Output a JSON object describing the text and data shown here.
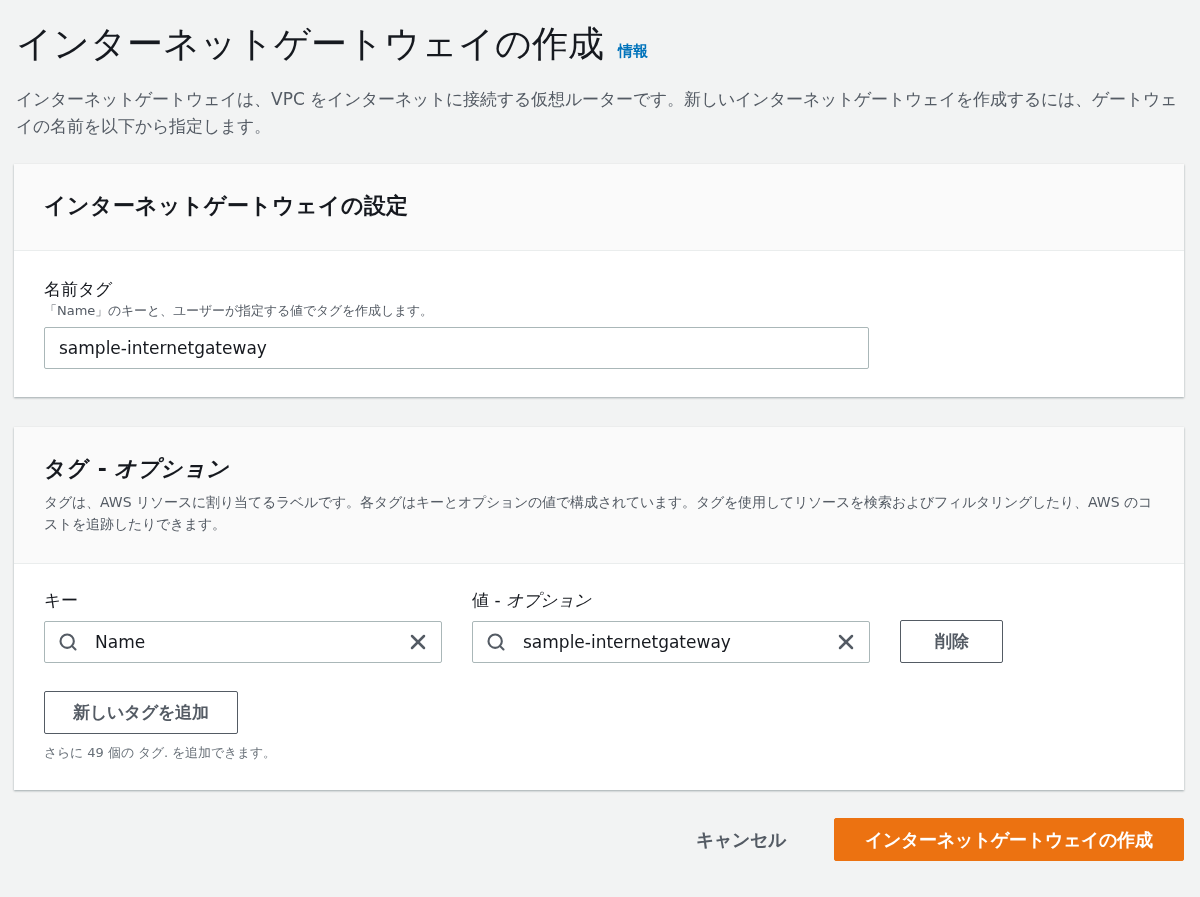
{
  "page": {
    "title": "インターネットゲートウェイの作成",
    "info_link": "情報",
    "description": "インターネットゲートウェイは、VPC をインターネットに接続する仮想ルーターです。新しいインターネットゲートウェイを作成するには、ゲートウェイの名前を以下から指定します。"
  },
  "settings_card": {
    "title": "インターネットゲートウェイの設定",
    "name_tag": {
      "label": "名前タグ",
      "hint": "「Name」のキーと、ユーザーが指定する値でタグを作成します。",
      "value": "sample-internetgateway"
    }
  },
  "tags_card": {
    "title": "タグ - *オプション*",
    "description": "タグは、AWS リソースに割り当てるラベルです。各タグはキーとオプションの値で構成されています。タグを使用してリソースを検索およびフィルタリングしたり、AWS のコストを追跡したりできます。",
    "key_label": "キー",
    "value_label": "値 - *オプション*",
    "tags": [
      {
        "key": "Name",
        "value": "sample-internetgateway",
        "remove": "削除"
      }
    ],
    "add_button": "新しいタグを追加",
    "remaining_note": "さらに 49 個の タグ. を追加できます。"
  },
  "actions": {
    "cancel": "キャンセル",
    "create": "インターネットゲートウェイの作成"
  }
}
